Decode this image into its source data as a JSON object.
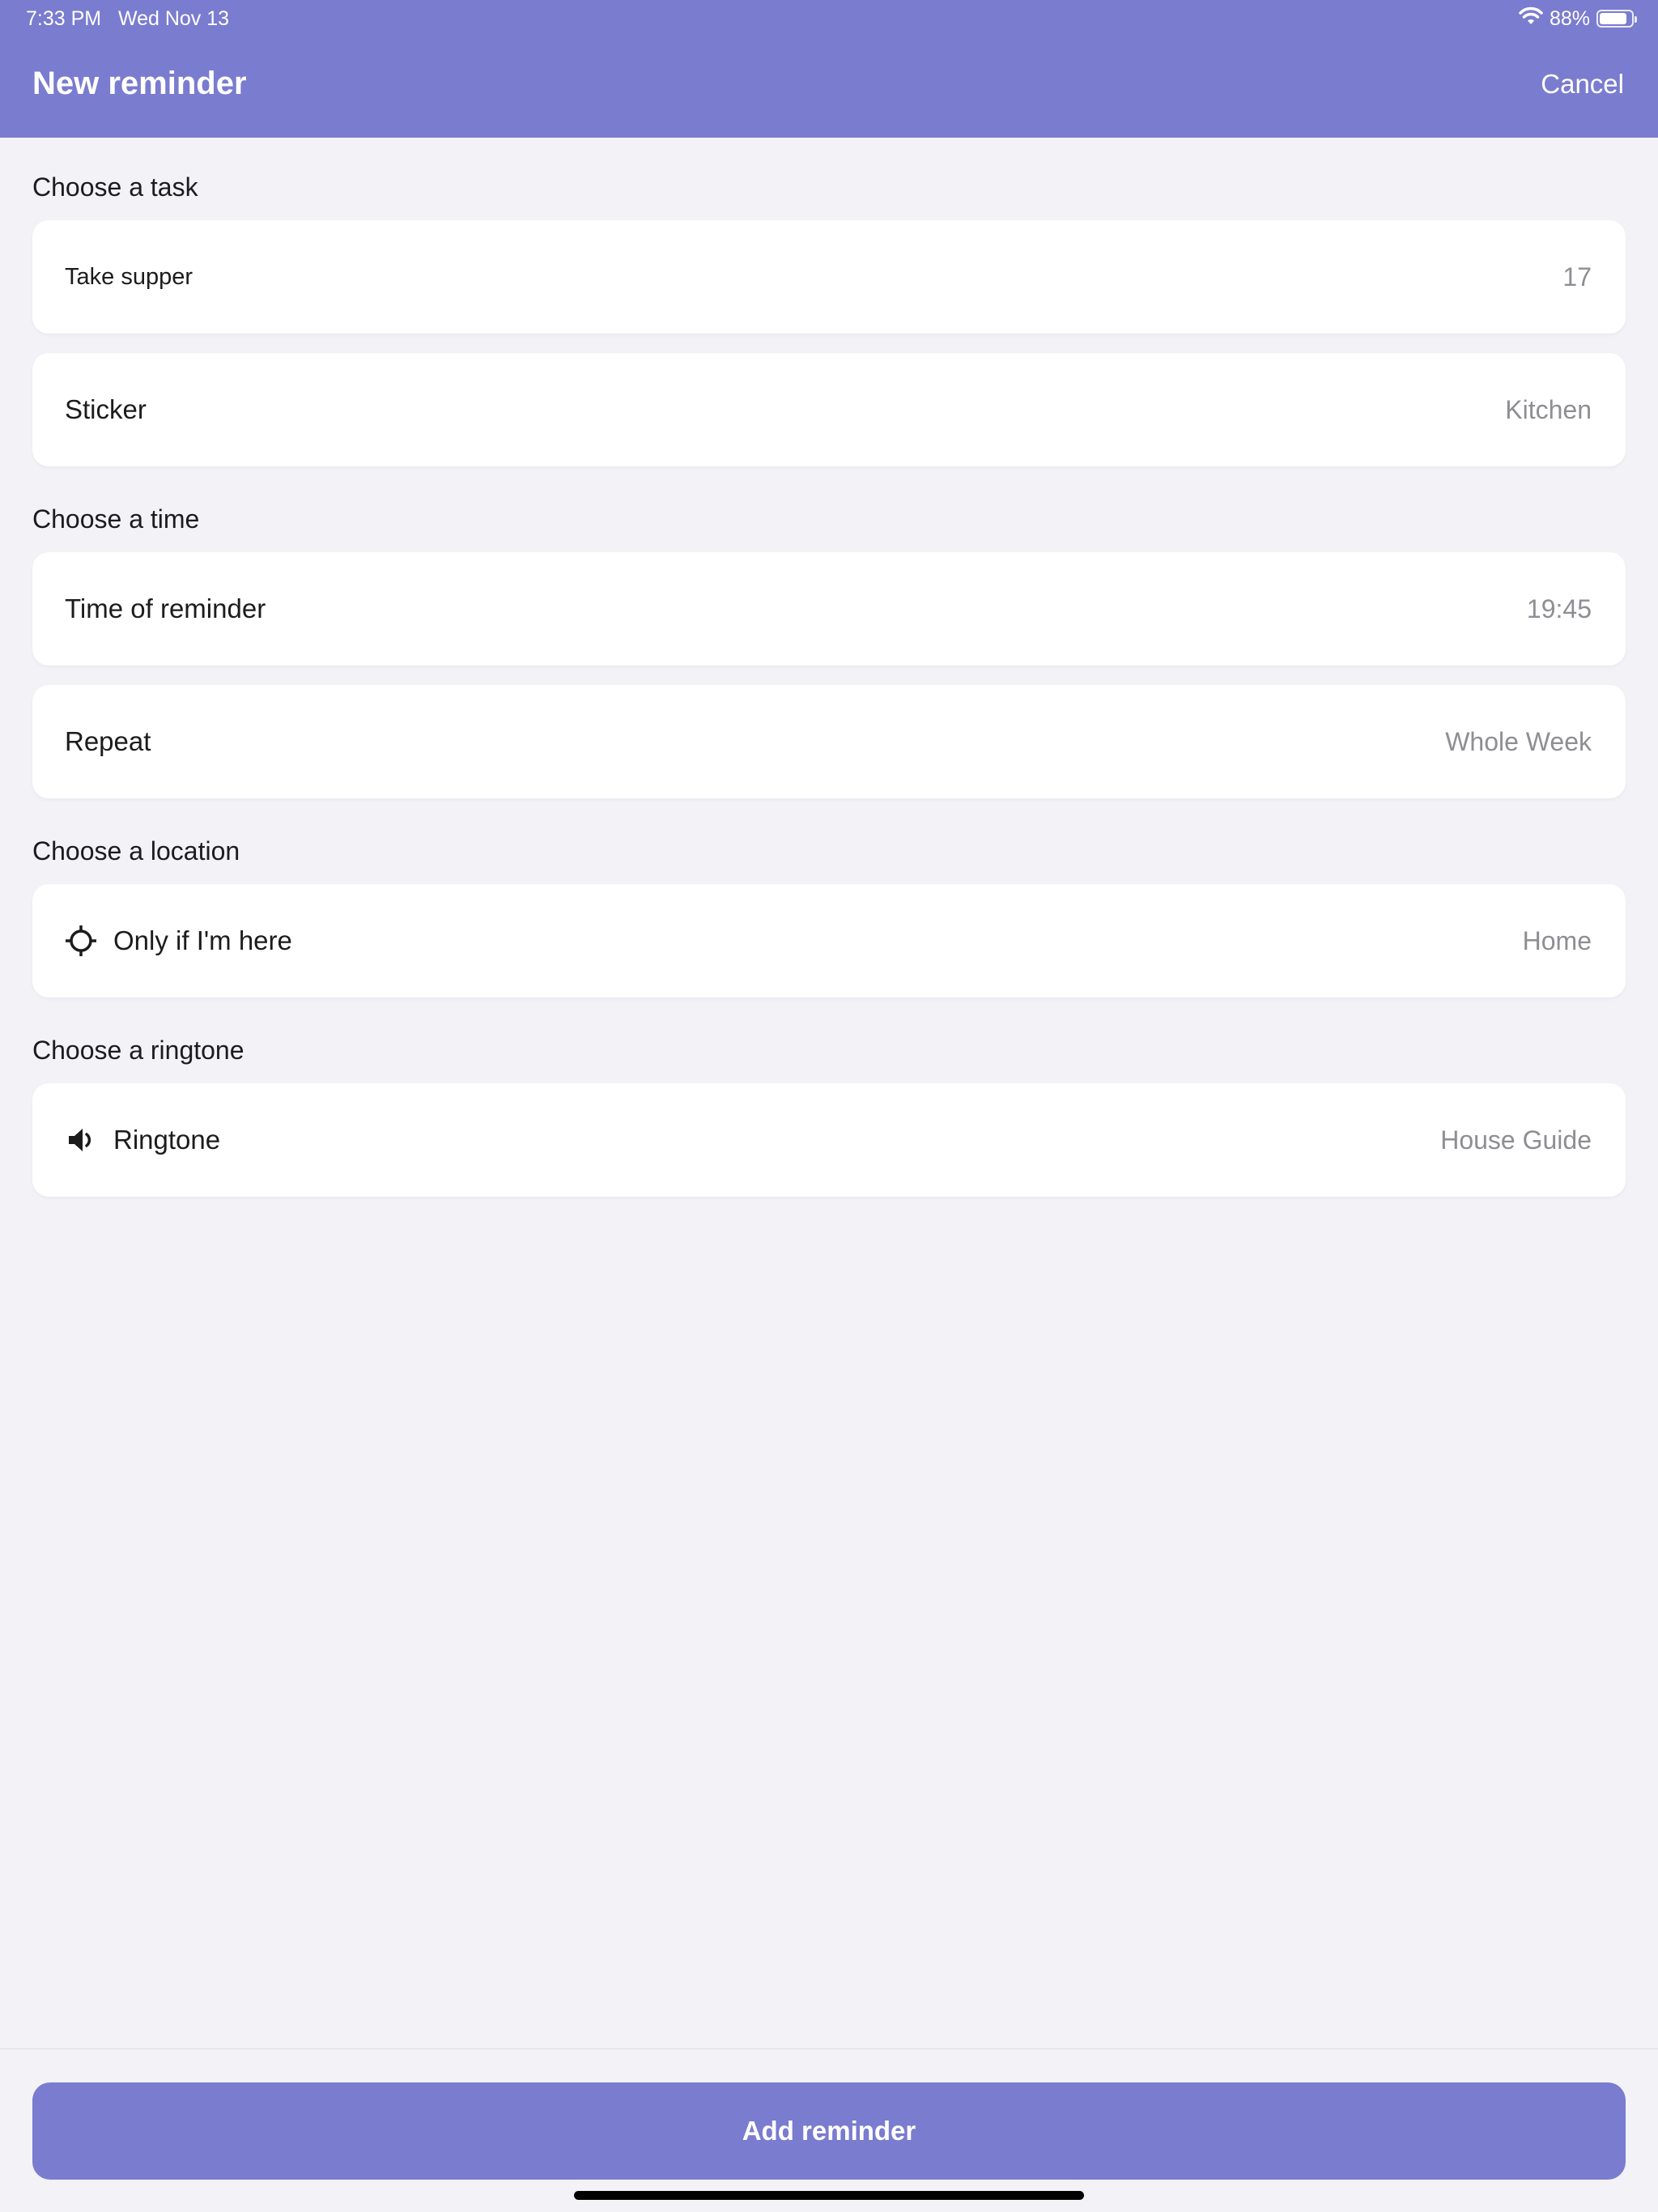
{
  "status_bar": {
    "time": "7:33 PM",
    "date": "Wed Nov 13",
    "battery": "88%",
    "battery_level": 0.88
  },
  "nav": {
    "title": "New reminder",
    "cancel_label": "Cancel"
  },
  "sections": {
    "task": {
      "title": "Choose a task",
      "task_row": {
        "label": "Take supper",
        "value": "17"
      },
      "sticker_row": {
        "label": "Sticker",
        "value": "Kitchen"
      }
    },
    "time": {
      "title": "Choose a time",
      "time_row": {
        "label": "Time of reminder",
        "value": "19:45"
      },
      "repeat_row": {
        "label": "Repeat",
        "value": "Whole Week"
      }
    },
    "location": {
      "title": "Choose a location",
      "location_row": {
        "label": "Only if I'm here",
        "value": "Home",
        "icon": "location-crosshair-icon"
      }
    },
    "ringtone": {
      "title": "Choose a ringtone",
      "ringtone_row": {
        "label": "Ringtone",
        "value": "House Guide",
        "icon": "speaker-icon"
      }
    }
  },
  "footer": {
    "add_label": "Add reminder"
  },
  "colors": {
    "accent": "#7a7ccf",
    "background": "#f2f2f7",
    "secondary_text": "#8e8e93"
  }
}
